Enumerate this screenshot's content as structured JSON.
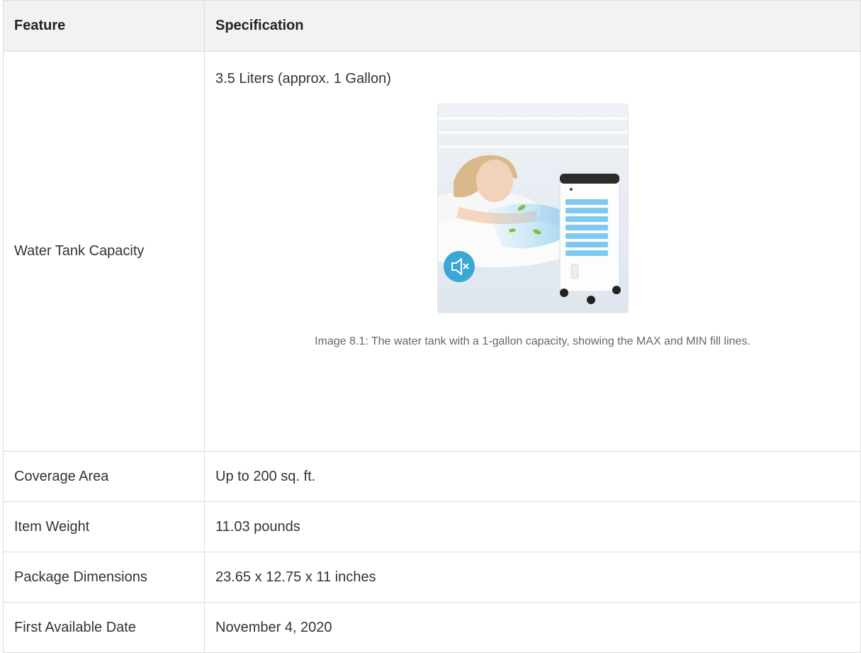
{
  "table": {
    "headers": {
      "feature": "Feature",
      "specification": "Specification"
    },
    "water_tank": {
      "label": "Water Tank Capacity",
      "value": "3.5 Liters (approx. 1 Gallon)",
      "image_caption": "Image 8.1: The water tank with a 1-gallon capacity, showing the MAX and MIN fill lines."
    },
    "rows": [
      {
        "label": "Coverage Area",
        "value": "Up to 200 sq. ft."
      },
      {
        "label": "Item Weight",
        "value": "11.03 pounds"
      },
      {
        "label": "Package Dimensions",
        "value": "23.65 x 12.75 x 11 inches"
      },
      {
        "label": "First Available Date",
        "value": "November 4, 2020"
      }
    ]
  },
  "colors": {
    "header_bg": "#f2f2f2",
    "border": "#dddddd",
    "caption_text": "#666666",
    "mute_badge": "#3aa7d6"
  },
  "icons": {
    "mute": "speaker-muted-icon"
  }
}
